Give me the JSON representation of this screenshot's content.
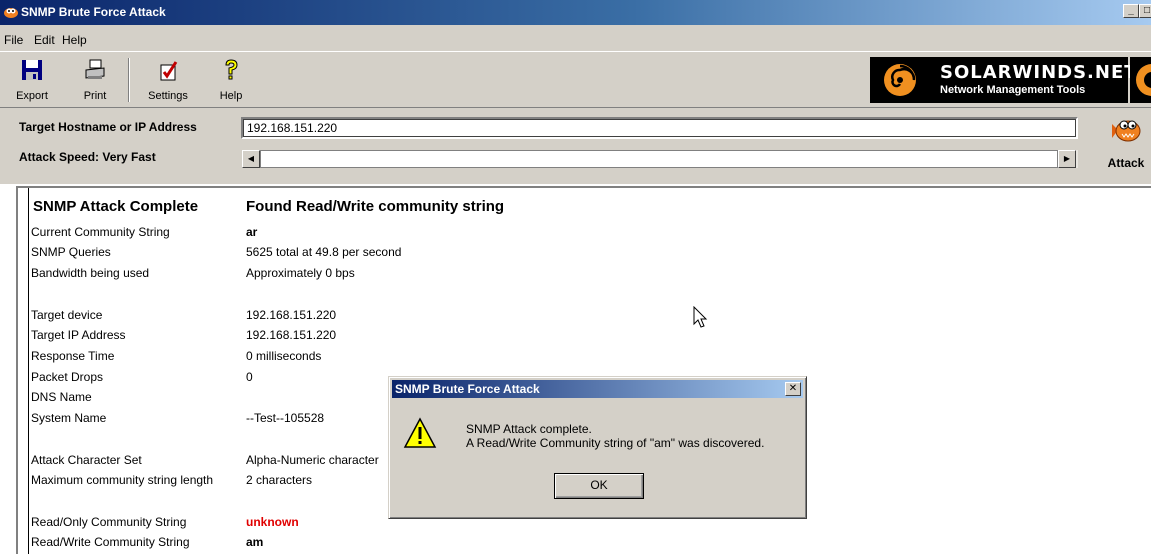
{
  "window": {
    "title": "SNMP Brute Force Attack",
    "controls": {
      "minimize": "_",
      "maximize": "□"
    }
  },
  "menu": [
    "File",
    "Edit",
    "Help"
  ],
  "toolbar": {
    "export_label": "Export",
    "print_label": "Print",
    "settings_label": "Settings",
    "help_label": "Help",
    "help_glyph": "?"
  },
  "banner": {
    "brand": "SOLARWINDS.NET",
    "tagline": "Network Management Tools"
  },
  "target": {
    "host_label": "Target Hostname or IP Address",
    "host_value": "192.168.151.220",
    "speed_label": "Attack Speed: Very Fast",
    "attack_label": "Attack"
  },
  "results": {
    "status_heading": "SNMP Attack Complete",
    "result_heading": "Found Read/Write community string",
    "rows": [
      {
        "label": "Current Community String",
        "value": "ar"
      },
      {
        "label": "SNMP Queries",
        "value": "5625 total at 49.8 per second"
      },
      {
        "label": "Bandwidth being used",
        "value": "Approximately 0 bps"
      },
      {
        "label": "Target device",
        "value": "192.168.151.220"
      },
      {
        "label": "Target IP Address",
        "value": "192.168.151.220"
      },
      {
        "label": "Response Time",
        "value": "0 milliseconds"
      },
      {
        "label": "Packet Drops",
        "value": "0"
      },
      {
        "label": "DNS Name",
        "value": ""
      },
      {
        "label": "System Name",
        "value": "--Test--105528"
      },
      {
        "label": "Attack Character Set",
        "value": "Alpha-Numeric character"
      },
      {
        "label": "Maximum community string length",
        "value": "2 characters"
      },
      {
        "label": "Read/Only Community String",
        "value": "unknown"
      },
      {
        "label": "Read/Write Community String",
        "value": "am"
      }
    ]
  },
  "dialog": {
    "title": "SNMP Brute Force Attack",
    "close_glyph": "✕",
    "line1": "SNMP Attack complete.",
    "line2": "A Read/Write Community string of \"am\" was discovered.",
    "ok_label": "OK"
  },
  "colors": {
    "titlebar_start": "#0a246a",
    "face": "#d4d0c8",
    "unknown_red": "#e00000"
  }
}
